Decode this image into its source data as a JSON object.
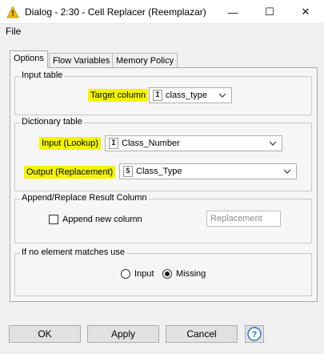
{
  "window": {
    "title": "Dialog - 2:30 - Cell Replacer (Reemplazar)",
    "minimize_glyph": "—",
    "maximize_glyph": "☐",
    "close_glyph": "✕",
    "app_icon": "warning-triangle-icon"
  },
  "menu": {
    "file": "File"
  },
  "tabs": [
    {
      "label": "Options",
      "active": true
    },
    {
      "label": "Flow Variables",
      "active": false
    },
    {
      "label": "Memory Policy",
      "active": false
    }
  ],
  "input_table": {
    "group_label": "Input table",
    "target_column_label": "Target column",
    "target_column": {
      "type_badge": "I",
      "value": "class_type"
    }
  },
  "dictionary_table": {
    "group_label": "Dictionary table",
    "input_label": "Input (Lookup)",
    "input": {
      "type_badge": "I",
      "value": "Class_Number"
    },
    "output_label": "Output (Replacement)",
    "output": {
      "type_badge": "S",
      "value": "Class_Type"
    }
  },
  "append_replace": {
    "group_label": "Append/Replace Result Column",
    "append_checkbox_label": "Append new column",
    "append_checked": false,
    "new_column_placeholder": "Replacement"
  },
  "no_match": {
    "group_label": "If no element matches use",
    "options": [
      "Input",
      "Missing"
    ],
    "selected": "Missing"
  },
  "buttons": {
    "ok": "OK",
    "apply": "Apply",
    "cancel": "Cancel",
    "help": "?"
  },
  "colors": {
    "highlight": "#f4f400",
    "help_icon": "#1e73c8"
  }
}
